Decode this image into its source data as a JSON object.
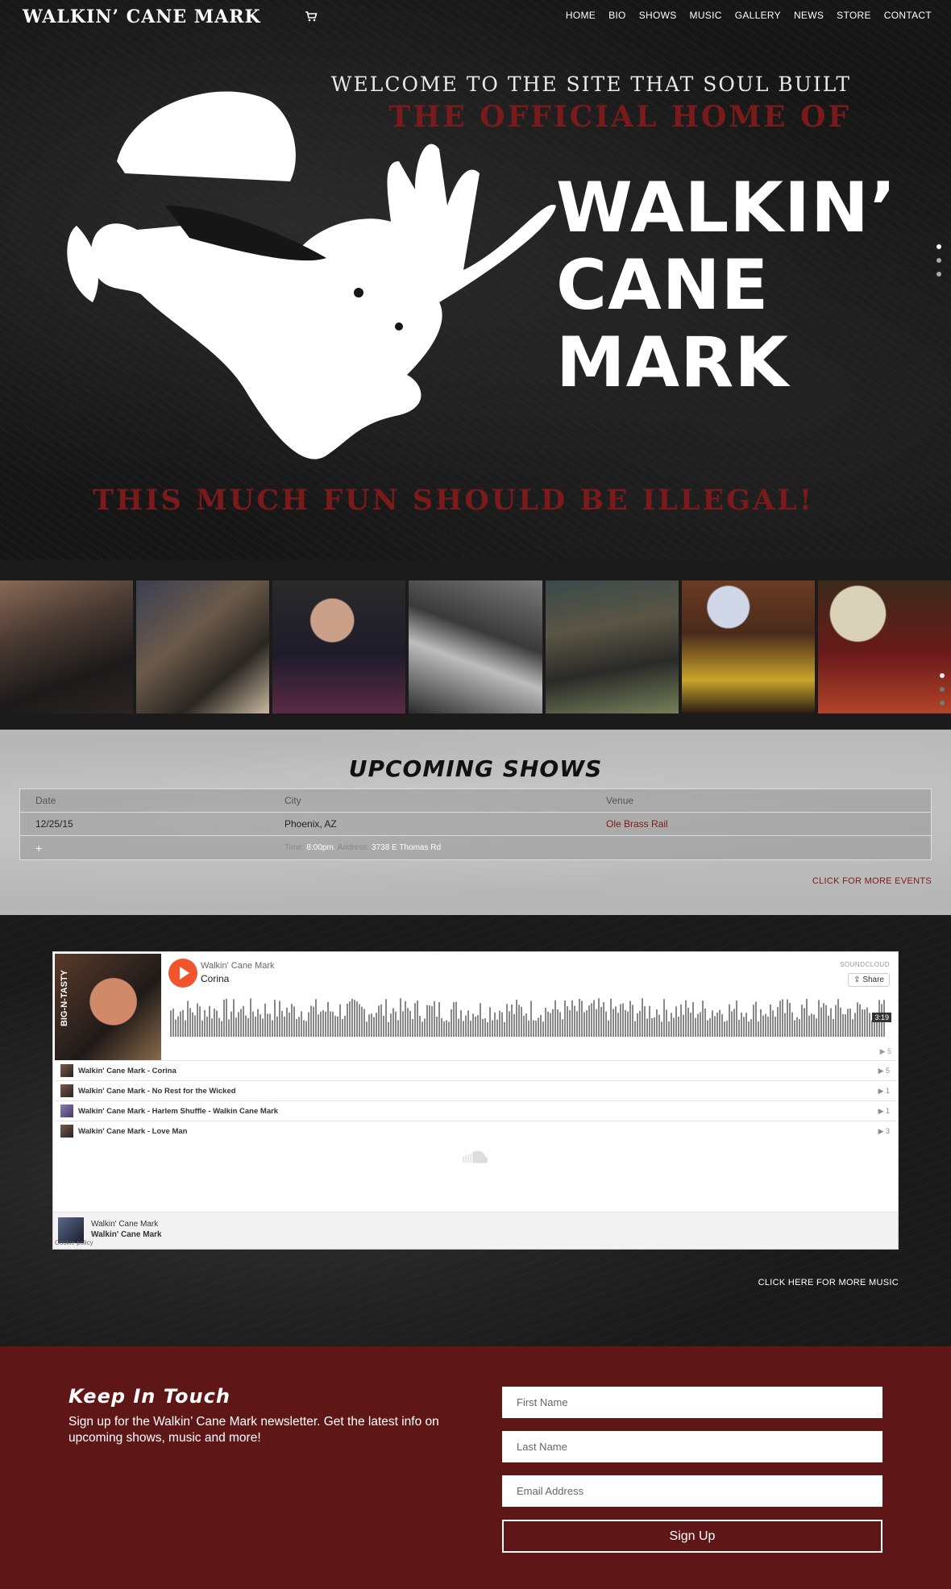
{
  "header": {
    "logo": "WALKIN’ CANE MARK",
    "nav": [
      "HOME",
      "BIO",
      "SHOWS",
      "MUSIC",
      "GALLERY",
      "NEWS",
      "STORE",
      "CONTACT"
    ]
  },
  "hero": {
    "welcome": "WELCOME TO THE SITE THAT SOUL BUILT",
    "official": "THE OFFICIAL HOME OF",
    "name_lines": [
      "WALKIN’",
      "CANE",
      "MARK"
    ],
    "tagline": "THIS MUCH FUN SHOULD BE ILLEGAL!",
    "slider_dots": 3,
    "active_dot": 0
  },
  "shows": {
    "title": "UPCOMING SHOWS",
    "columns": [
      "Date",
      "City",
      "Venue"
    ],
    "rows": [
      {
        "date": "12/25/15",
        "city": "Phoenix, AZ",
        "venue": "Ole Brass Rail"
      }
    ],
    "detail": {
      "time_label": "Time:",
      "time": "8:00pm.",
      "address_label": "Address:",
      "address": "3738 E Thomas Rd"
    },
    "more_link": "CLICK FOR MORE EVENTS"
  },
  "music": {
    "player": {
      "artist": "Walkin' Cane Mark",
      "track": "Corina",
      "brand": "SOUNDCLOUD",
      "share": "Share",
      "duration": "3:19",
      "cover_text": "BIG-N-TASTY",
      "play_count": "▶ 5"
    },
    "tracks": [
      {
        "title": "Walkin' Cane Mark - Corina",
        "count": "▶ 5"
      },
      {
        "title": "Walkin' Cane Mark - No Rest for the Wicked",
        "count": "▶ 1"
      },
      {
        "title": "Walkin' Cane Mark - Harlem Shuffle - Walkin Cane Mark",
        "count": "▶ 1"
      },
      {
        "title": "Walkin' Cane Mark - Love Man",
        "count": "▶ 3"
      }
    ],
    "footer": {
      "artist": "Walkin' Cane Mark",
      "title": "Walkin' Cane Mark",
      "cookie": "Cookie policy"
    },
    "more_link": "CLICK HERE FOR MORE MUSIC"
  },
  "newsletter": {
    "title": "Keep In Touch",
    "text": "Sign up for the Walkin’ Cane Mark newsletter. Get the latest info on upcoming shows, music and more!",
    "first_name_placeholder": "First Name",
    "last_name_placeholder": "Last Name",
    "email_placeholder": "Email Address",
    "button": "Sign Up"
  },
  "colors": {
    "accent_red": "#7a1a1a",
    "newsletter_bg": "#5f1616",
    "soundcloud_orange": "#f2542d"
  }
}
